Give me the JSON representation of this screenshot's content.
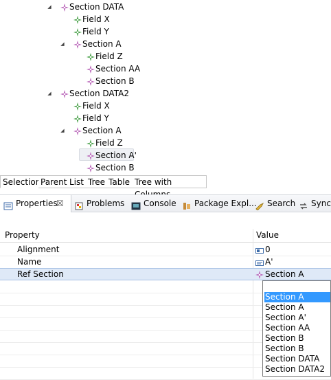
{
  "tree": [
    {
      "label": "Section DATA",
      "kind": "section",
      "level": 0,
      "expanded": true
    },
    {
      "label": "Field X",
      "kind": "field",
      "level": 1
    },
    {
      "label": "Field Y",
      "kind": "field",
      "level": 1
    },
    {
      "label": "Section A",
      "kind": "section",
      "level": 1,
      "expanded": true
    },
    {
      "label": "Field Z",
      "kind": "field",
      "level": 2
    },
    {
      "label": "Section AA",
      "kind": "section",
      "level": 2
    },
    {
      "label": "Section B",
      "kind": "section",
      "level": 2
    },
    {
      "label": "Section DATA2",
      "kind": "section",
      "level": 0,
      "expanded": true
    },
    {
      "label": "Field X",
      "kind": "field",
      "level": 1
    },
    {
      "label": "Field Y",
      "kind": "field",
      "level": 1
    },
    {
      "label": "Section A",
      "kind": "section",
      "level": 1,
      "expanded": true
    },
    {
      "label": "Field Z",
      "kind": "field",
      "level": 2
    },
    {
      "label": "Section A'",
      "kind": "section",
      "level": 2,
      "selected": true
    },
    {
      "label": "Section B",
      "kind": "section",
      "level": 2
    }
  ],
  "viewer_tabs": [
    "Selection",
    "Parent",
    "List",
    "Tree",
    "Table",
    "Tree with Columns"
  ],
  "views": [
    {
      "label": "Properties",
      "icon": "properties-icon",
      "active": true,
      "closable": true
    },
    {
      "label": "Problems",
      "icon": "problems-icon"
    },
    {
      "label": "Console",
      "icon": "console-icon"
    },
    {
      "label": "Package Expl...",
      "icon": "package-explorer-icon"
    },
    {
      "label": "Search",
      "icon": "search-icon"
    },
    {
      "label": "Synch",
      "icon": "synchronize-icon"
    }
  ],
  "properties": {
    "header": {
      "property": "Property",
      "value": "Value"
    },
    "rows": [
      {
        "name": "Alignment",
        "value": "0",
        "icon": "number-icon"
      },
      {
        "name": "Name",
        "value": "A'",
        "icon": "text-icon"
      },
      {
        "name": "Ref Section",
        "value": "Section A",
        "icon": "section-icon",
        "selected": true
      }
    ]
  },
  "dropdown": {
    "selected_index": 0,
    "options": [
      "Section A",
      "Section A",
      "Section A'",
      "Section AA",
      "Section B",
      "Section B",
      "Section DATA",
      "Section DATA2"
    ]
  },
  "colors": {
    "section": "#b45ab4",
    "field": "#3c9a3c",
    "selection": "#3399ff"
  }
}
